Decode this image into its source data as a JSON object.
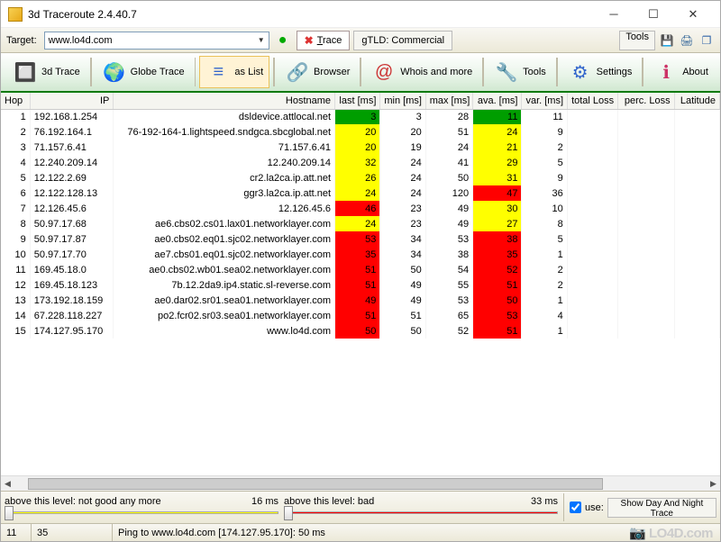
{
  "window": {
    "title": "3d Traceroute 2.4.40.7"
  },
  "toolbar1": {
    "target_label": "Target:",
    "target_value": "www.lo4d.com",
    "trace_label": "Trace",
    "gtld_label": "gTLD: Commercial",
    "tools_label": "Tools"
  },
  "toolbar2": {
    "trace3d": "3d Trace",
    "globe": "Globe Trace",
    "aslist": "as List",
    "browser": "Browser",
    "whois": "Whois and more",
    "tools": "Tools",
    "settings": "Settings",
    "about": "About"
  },
  "columns": [
    "Hop",
    "IP",
    "Hostname",
    "last [ms]",
    "min [ms]",
    "max [ms]",
    "ava. [ms]",
    "var. [ms]",
    "total Loss",
    "perc. Loss",
    "Latitude"
  ],
  "rows": [
    {
      "hop": "1",
      "ip": "192.168.1.254",
      "host": "dsldevice.attlocal.net",
      "last": "3",
      "last_c": "green",
      "min": "3",
      "max": "28",
      "ava": "11",
      "ava_c": "green",
      "var": "11"
    },
    {
      "hop": "2",
      "ip": "76.192.164.1",
      "host": "76-192-164-1.lightspeed.sndgca.sbcglobal.net",
      "last": "20",
      "last_c": "yellow",
      "min": "20",
      "max": "51",
      "ava": "24",
      "ava_c": "yellow",
      "var": "9"
    },
    {
      "hop": "3",
      "ip": "71.157.6.41",
      "host": "71.157.6.41",
      "last": "20",
      "last_c": "yellow",
      "min": "19",
      "max": "24",
      "ava": "21",
      "ava_c": "yellow",
      "var": "2"
    },
    {
      "hop": "4",
      "ip": "12.240.209.14",
      "host": "12.240.209.14",
      "last": "32",
      "last_c": "yellow",
      "min": "24",
      "max": "41",
      "ava": "29",
      "ava_c": "yellow",
      "var": "5"
    },
    {
      "hop": "5",
      "ip": "12.122.2.69",
      "host": "cr2.la2ca.ip.att.net",
      "last": "26",
      "last_c": "yellow",
      "min": "24",
      "max": "50",
      "ava": "31",
      "ava_c": "yellow",
      "var": "9"
    },
    {
      "hop": "6",
      "ip": "12.122.128.13",
      "host": "ggr3.la2ca.ip.att.net",
      "last": "24",
      "last_c": "yellow",
      "min": "24",
      "max": "120",
      "ava": "47",
      "ava_c": "red",
      "var": "36"
    },
    {
      "hop": "7",
      "ip": "12.126.45.6",
      "host": "12.126.45.6",
      "last": "46",
      "last_c": "red",
      "min": "23",
      "max": "49",
      "ava": "30",
      "ava_c": "yellow",
      "var": "10"
    },
    {
      "hop": "8",
      "ip": "50.97.17.68",
      "host": "ae6.cbs02.cs01.lax01.networklayer.com",
      "last": "24",
      "last_c": "yellow",
      "min": "23",
      "max": "49",
      "ava": "27",
      "ava_c": "yellow",
      "var": "8"
    },
    {
      "hop": "9",
      "ip": "50.97.17.87",
      "host": "ae0.cbs02.eq01.sjc02.networklayer.com",
      "last": "53",
      "last_c": "red",
      "min": "34",
      "max": "53",
      "ava": "38",
      "ava_c": "red",
      "var": "5"
    },
    {
      "hop": "10",
      "ip": "50.97.17.70",
      "host": "ae7.cbs01.eq01.sjc02.networklayer.com",
      "last": "35",
      "last_c": "red",
      "min": "34",
      "max": "38",
      "ava": "35",
      "ava_c": "red",
      "var": "1"
    },
    {
      "hop": "11",
      "ip": "169.45.18.0",
      "host": "ae0.cbs02.wb01.sea02.networklayer.com",
      "last": "51",
      "last_c": "red",
      "min": "50",
      "max": "54",
      "ava": "52",
      "ava_c": "red",
      "var": "2"
    },
    {
      "hop": "12",
      "ip": "169.45.18.123",
      "host": "7b.12.2da9.ip4.static.sl-reverse.com",
      "last": "51",
      "last_c": "red",
      "min": "49",
      "max": "55",
      "ava": "51",
      "ava_c": "red",
      "var": "2"
    },
    {
      "hop": "13",
      "ip": "173.192.18.159",
      "host": "ae0.dar02.sr01.sea01.networklayer.com",
      "last": "49",
      "last_c": "red",
      "min": "49",
      "max": "53",
      "ava": "50",
      "ava_c": "red",
      "var": "1"
    },
    {
      "hop": "14",
      "ip": "67.228.118.227",
      "host": "po2.fcr02.sr03.sea01.networklayer.com",
      "last": "51",
      "last_c": "red",
      "min": "51",
      "max": "65",
      "ava": "53",
      "ava_c": "red",
      "var": "4"
    },
    {
      "hop": "15",
      "ip": "174.127.95.170",
      "host": "www.lo4d.com",
      "last": "50",
      "last_c": "red",
      "min": "50",
      "max": "52",
      "ava": "51",
      "ava_c": "red",
      "var": "1"
    }
  ],
  "sliders": {
    "yellow_label": "above this level: not good any more",
    "yellow_value": "16 ms",
    "red_label": "above this level: bad",
    "red_value": "33 ms",
    "use_label": "use:",
    "show_btn": "Show Day And Night Trace"
  },
  "status": {
    "left1": "11",
    "left2": "35",
    "ping": "Ping to www.lo4d.com [174.127.95.170]: 50 ms",
    "watermark": "📷 LO4D.com"
  }
}
